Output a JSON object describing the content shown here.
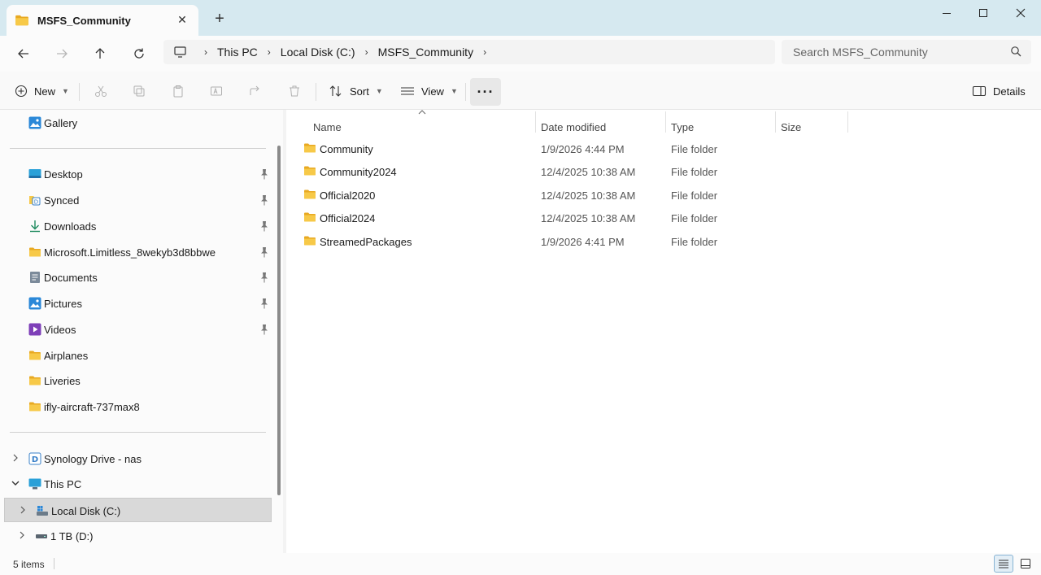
{
  "window": {
    "tab_title": "MSFS_Community",
    "controls": {
      "minimize": "—",
      "maximize": "☐",
      "close": "✕"
    }
  },
  "address": {
    "breadcrumbs": [
      "This PC",
      "Local Disk (C:)",
      "MSFS_Community"
    ],
    "search_placeholder": "Search MSFS_Community"
  },
  "toolbar": {
    "new_label": "New",
    "sort_label": "Sort",
    "view_label": "View",
    "more_label": "···",
    "details_label": "Details"
  },
  "nav": {
    "gallery": "Gallery",
    "pinned": [
      {
        "label": "Desktop",
        "icon": "desktop-icon"
      },
      {
        "label": "Synced",
        "icon": "synced-icon"
      },
      {
        "label": "Downloads",
        "icon": "downloads-icon"
      },
      {
        "label": "Microsoft.Limitless_8wekyb3d8bbwe",
        "icon": "folder-icon"
      },
      {
        "label": "Documents",
        "icon": "documents-icon"
      },
      {
        "label": "Pictures",
        "icon": "pictures-icon"
      },
      {
        "label": "Videos",
        "icon": "videos-icon"
      }
    ],
    "folders": [
      "Airplanes",
      "Liveries",
      "ifly-aircraft-737max8"
    ],
    "tree": {
      "synology": "Synology Drive - nas",
      "this_pc": "This PC",
      "local_disk": "Local Disk (C:)",
      "tb_drive": "1 TB (D:)"
    }
  },
  "columns": {
    "name": "Name",
    "date": "Date modified",
    "type": "Type",
    "size": "Size"
  },
  "files": [
    {
      "name": "Community",
      "date": "1/9/2026 4:44 PM",
      "type": "File folder"
    },
    {
      "name": "Community2024",
      "date": "12/4/2025 10:38 AM",
      "type": "File folder"
    },
    {
      "name": "Official2020",
      "date": "12/4/2025 10:38 AM",
      "type": "File folder"
    },
    {
      "name": "Official2024",
      "date": "12/4/2025 10:38 AM",
      "type": "File folder"
    },
    {
      "name": "StreamedPackages",
      "date": "1/9/2026 4:41 PM",
      "type": "File folder"
    }
  ],
  "status": {
    "item_count": "5 items"
  },
  "colors": {
    "titlebar": "#d6e9f0",
    "folder": "#f5c342",
    "accent": "#0067c0"
  }
}
